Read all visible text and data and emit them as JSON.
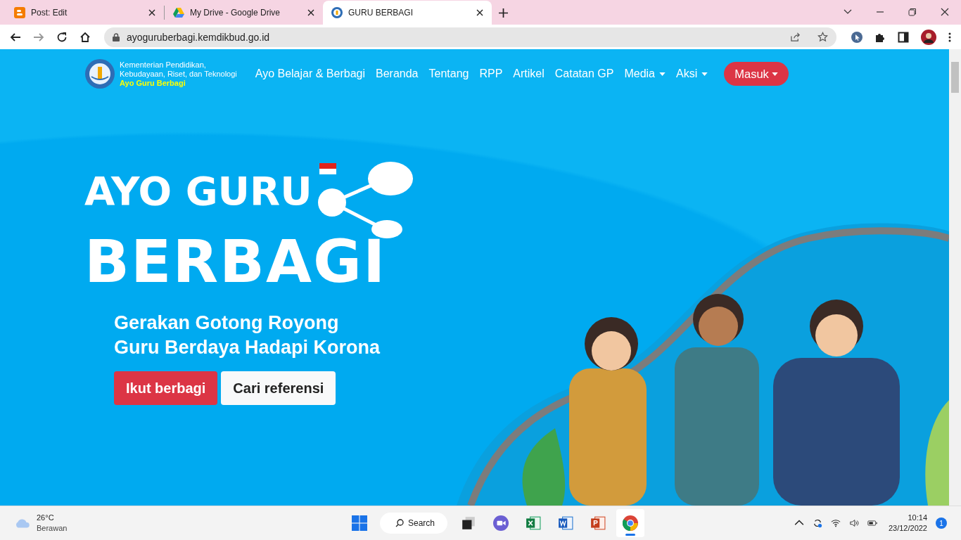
{
  "browser": {
    "tabs": [
      {
        "title": "Post: Edit",
        "kind": "blogger",
        "selected": false
      },
      {
        "title": "My Drive - Google Drive",
        "kind": "drive",
        "selected": false
      },
      {
        "title": "GURU BERBAGI",
        "kind": "site",
        "selected": true
      }
    ],
    "address": "ayoguruberbagi.kemdikbud.go.id"
  },
  "site": {
    "org_lines": [
      "Kementerian Pendidikan,",
      "Kebudayaan, Riset, dan Teknologi"
    ],
    "tagline": "Ayo Guru Berbagi",
    "nav": [
      {
        "label": "Ayo Belajar & Berbagi",
        "dropdown": false
      },
      {
        "label": "Beranda",
        "dropdown": false
      },
      {
        "label": "Tentang",
        "dropdown": false
      },
      {
        "label": "RPP",
        "dropdown": false
      },
      {
        "label": "Artikel",
        "dropdown": false
      },
      {
        "label": "Catatan GP",
        "dropdown": false
      },
      {
        "label": "Media",
        "dropdown": true
      },
      {
        "label": "Aksi",
        "dropdown": true
      }
    ],
    "login_button": "Masuk"
  },
  "hero": {
    "logo_lines": [
      "AYO GURU",
      "BERBAGI"
    ],
    "headline_lines": [
      "Gerakan Gotong Royong",
      "Guru Berdaya Hadapi Korona"
    ],
    "buttons": [
      {
        "label": "Ikut berbagi",
        "kind": "primary"
      },
      {
        "label": "Cari referensi",
        "kind": "secondary"
      }
    ]
  },
  "taskbar": {
    "temperature": "26°C",
    "condition": "Berawan",
    "search": "Search",
    "apps": [
      {
        "kind": "taskview",
        "selected": false
      },
      {
        "kind": "meet",
        "selected": false
      },
      {
        "kind": "excel",
        "selected": false
      },
      {
        "kind": "word",
        "selected": false
      },
      {
        "kind": "powerpoint",
        "selected": false
      },
      {
        "kind": "chrome",
        "selected": true
      }
    ],
    "time": "10:14",
    "date": "23/12/2022",
    "notifications": "1"
  }
}
